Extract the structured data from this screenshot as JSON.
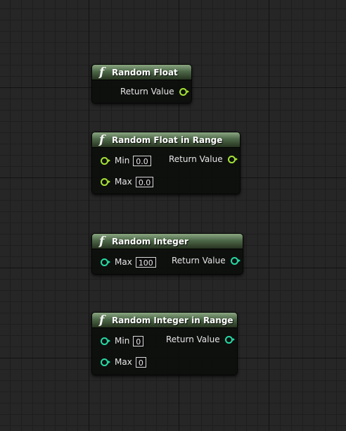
{
  "nodes": [
    {
      "title": "Random Float",
      "icon": "function-icon",
      "return_label": "Return Value",
      "pin_type": "float"
    },
    {
      "title": "Random Float in Range",
      "icon": "function-icon",
      "inputs": [
        {
          "label": "Min",
          "value": "0.0"
        },
        {
          "label": "Max",
          "value": "0.0"
        }
      ],
      "return_label": "Return Value",
      "pin_type": "float"
    },
    {
      "title": "Random Integer",
      "icon": "function-icon",
      "inputs": [
        {
          "label": "Max",
          "value": "100"
        }
      ],
      "return_label": "Return Value",
      "pin_type": "integer"
    },
    {
      "title": "Random Integer in Range",
      "icon": "function-icon",
      "inputs": [
        {
          "label": "Min",
          "value": "0"
        },
        {
          "label": "Max",
          "value": "0"
        }
      ],
      "return_label": "Return Value",
      "pin_type": "integer"
    }
  ],
  "colors": {
    "float_pin": "#a4e234",
    "integer_pin": "#26d9a4",
    "header_top": "#8aa681",
    "canvas_bg": "#262626"
  }
}
